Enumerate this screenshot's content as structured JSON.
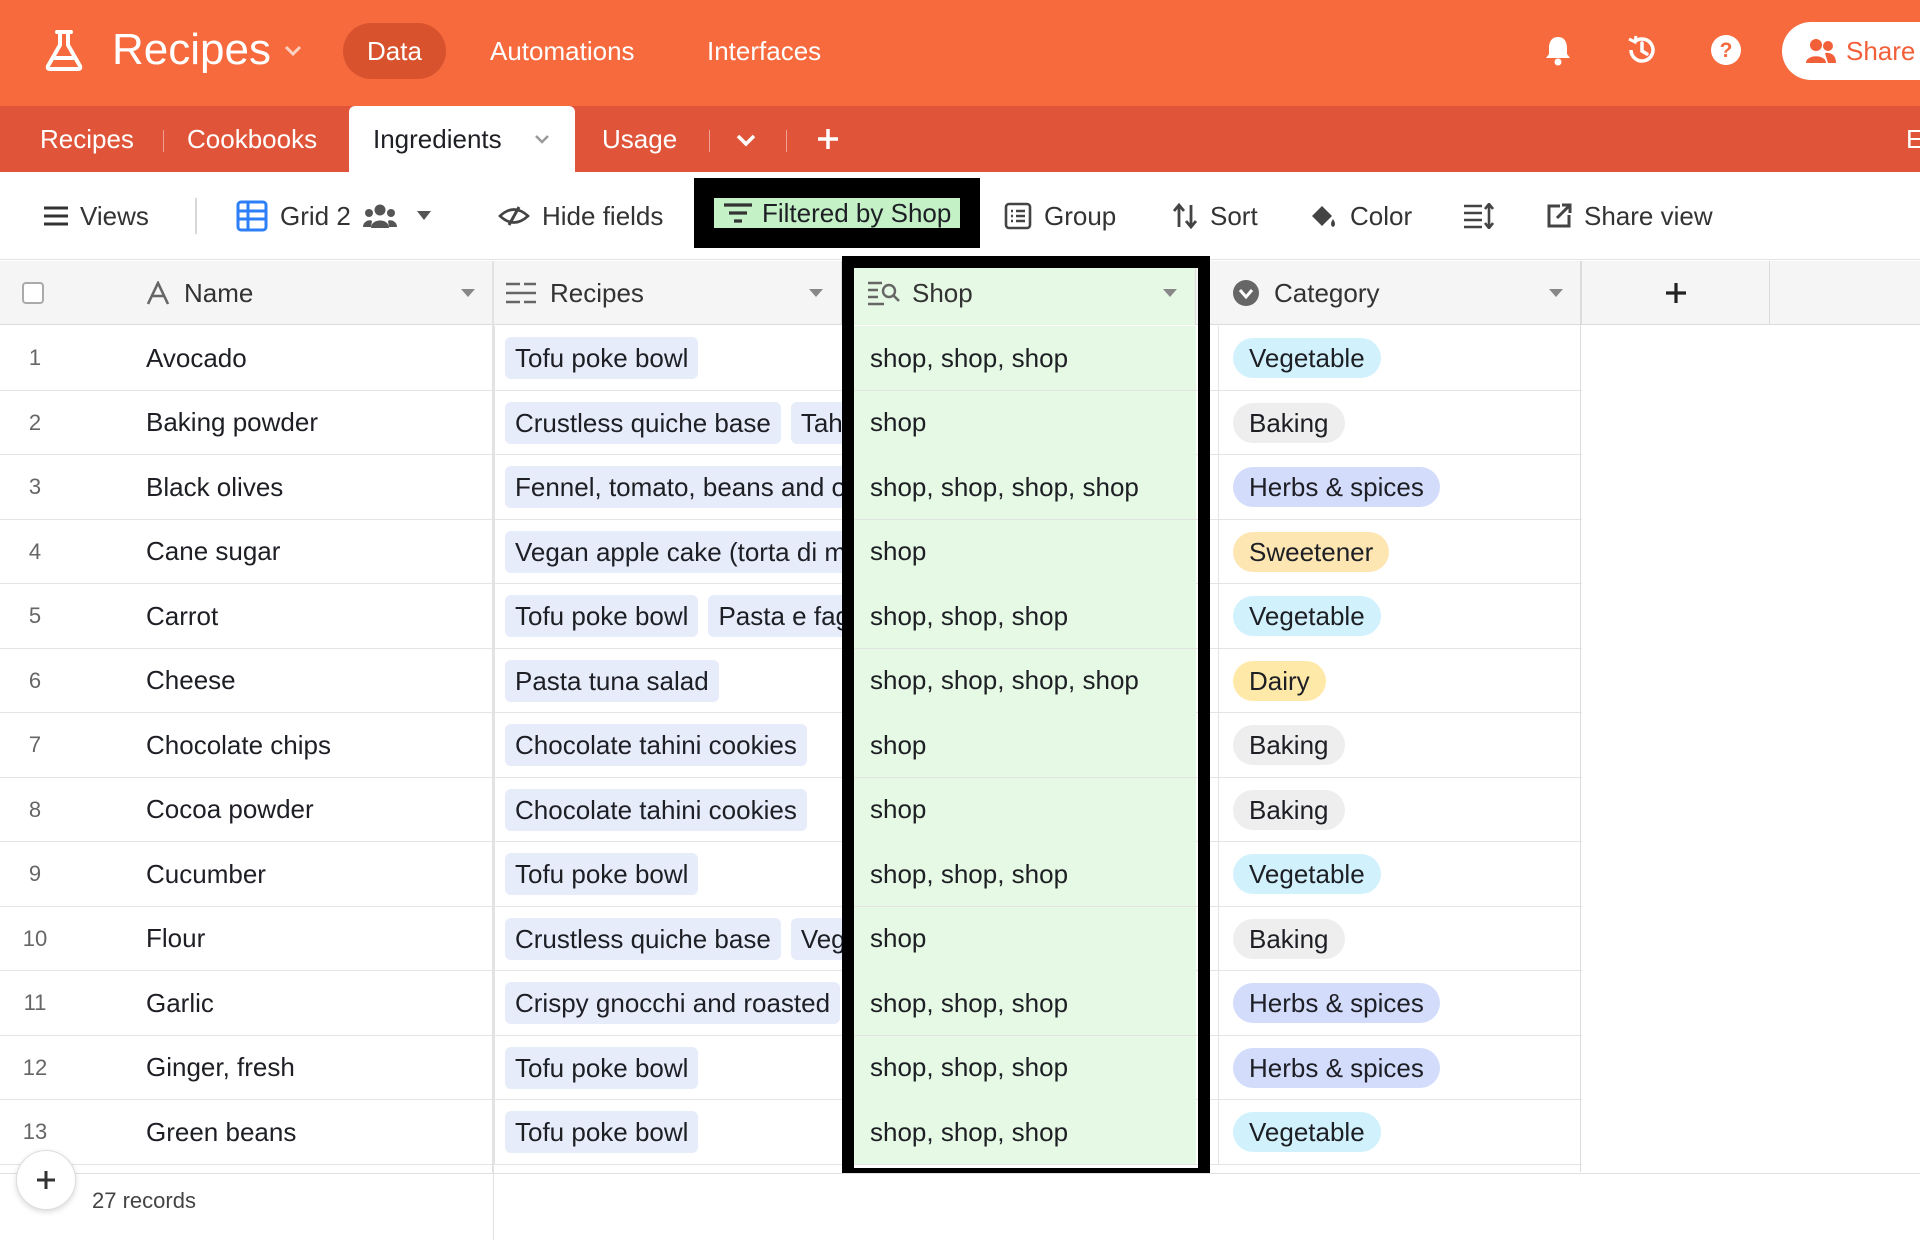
{
  "header": {
    "app_name": "Recipes",
    "nav": [
      "Data",
      "Automations",
      "Interfaces"
    ],
    "share_label": "Share",
    "accent": "#f66a3e"
  },
  "tabs": {
    "items": [
      "Recipes",
      "Cookbooks",
      "Ingredients",
      "Usage"
    ],
    "active": "Ingredients",
    "overflow_letter": "E"
  },
  "toolbar": {
    "views": "Views",
    "grid_name": "Grid 2",
    "hide_fields": "Hide fields",
    "filter": "Filtered by Shop",
    "group": "Group",
    "sort": "Sort",
    "color": "Color",
    "share_view": "Share view"
  },
  "columns": {
    "name": "Name",
    "recipes": "Recipes",
    "shop": "Shop",
    "category": "Category"
  },
  "rows": [
    {
      "n": "1",
      "name": "Avocado",
      "recipes": [
        "Tofu poke bowl"
      ],
      "shop": "shop, shop, shop",
      "category": "Vegetable"
    },
    {
      "n": "2",
      "name": "Baking powder",
      "recipes": [
        "Crustless quiche base",
        "Tahini"
      ],
      "shop": "shop",
      "category": "Baking"
    },
    {
      "n": "3",
      "name": "Black olives",
      "recipes": [
        "Fennel, tomato, beans and olives"
      ],
      "shop": "shop, shop, shop, shop",
      "category": "Herbs & spices"
    },
    {
      "n": "4",
      "name": "Cane sugar",
      "recipes": [
        "Vegan apple cake (torta di mele)"
      ],
      "shop": "shop",
      "category": "Sweetener"
    },
    {
      "n": "5",
      "name": "Carrot",
      "recipes": [
        "Tofu poke bowl",
        "Pasta e fagioli"
      ],
      "shop": "shop, shop, shop",
      "category": "Vegetable"
    },
    {
      "n": "6",
      "name": "Cheese",
      "recipes": [
        "Pasta tuna salad"
      ],
      "shop": "shop, shop, shop, shop",
      "category": "Dairy"
    },
    {
      "n": "7",
      "name": "Chocolate chips",
      "recipes": [
        "Chocolate tahini cookies"
      ],
      "shop": "shop",
      "category": "Baking"
    },
    {
      "n": "8",
      "name": "Cocoa powder",
      "recipes": [
        "Chocolate tahini cookies"
      ],
      "shop": "shop",
      "category": "Baking"
    },
    {
      "n": "9",
      "name": "Cucumber",
      "recipes": [
        "Tofu poke bowl"
      ],
      "shop": "shop, shop, shop",
      "category": "Vegetable"
    },
    {
      "n": "10",
      "name": "Flour",
      "recipes": [
        "Crustless quiche base",
        "Vegan"
      ],
      "shop": "shop",
      "category": "Baking"
    },
    {
      "n": "11",
      "name": "Garlic",
      "recipes": [
        "Crispy gnocchi and roasted"
      ],
      "shop": "shop, shop, shop",
      "category": "Herbs & spices"
    },
    {
      "n": "12",
      "name": "Ginger, fresh",
      "recipes": [
        "Tofu poke bowl"
      ],
      "shop": "shop, shop, shop",
      "category": "Herbs & spices"
    },
    {
      "n": "13",
      "name": "Green beans",
      "recipes": [
        "Tofu poke bowl"
      ],
      "shop": "shop, shop, shop",
      "category": "Vegetable"
    }
  ],
  "category_colors": {
    "Vegetable": "#d1f2fc",
    "Baking": "#eeeeee",
    "Herbs & spices": "#d4dcfc",
    "Sweetener": "#fde6b2",
    "Dairy": "#ffe9a8"
  },
  "footer": {
    "records": "27 records"
  }
}
